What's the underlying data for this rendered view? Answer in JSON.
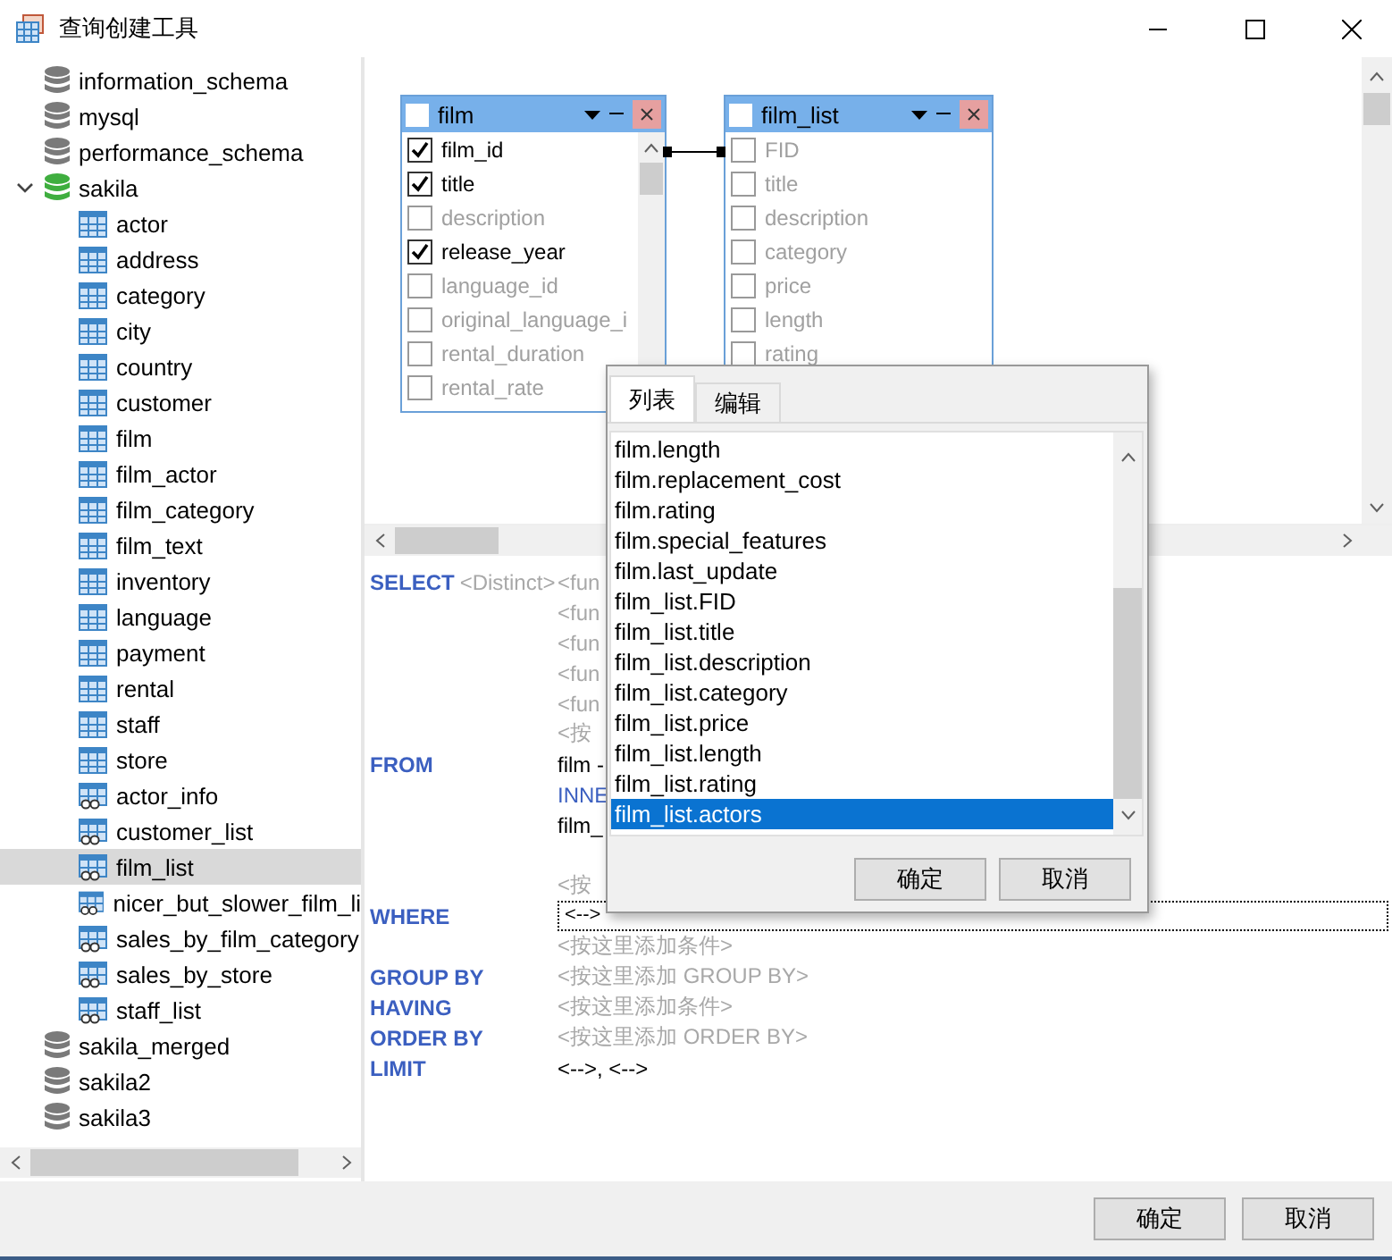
{
  "window": {
    "title": "查询创建工具"
  },
  "tree": [
    {
      "label": "information_schema",
      "kind": "database",
      "active": false,
      "selected": false
    },
    {
      "label": "mysql",
      "kind": "database",
      "active": false,
      "selected": false
    },
    {
      "label": "performance_schema",
      "kind": "database",
      "active": false,
      "selected": false
    },
    {
      "label": "sakila",
      "kind": "database",
      "active": true,
      "expanded": true,
      "selected": false,
      "children": [
        {
          "label": "actor",
          "kind": "table",
          "selected": false
        },
        {
          "label": "address",
          "kind": "table",
          "selected": false
        },
        {
          "label": "category",
          "kind": "table",
          "selected": false
        },
        {
          "label": "city",
          "kind": "table",
          "selected": false
        },
        {
          "label": "country",
          "kind": "table",
          "selected": false
        },
        {
          "label": "customer",
          "kind": "table",
          "selected": false
        },
        {
          "label": "film",
          "kind": "table",
          "selected": false
        },
        {
          "label": "film_actor",
          "kind": "table",
          "selected": false
        },
        {
          "label": "film_category",
          "kind": "table",
          "selected": false
        },
        {
          "label": "film_text",
          "kind": "table",
          "selected": false
        },
        {
          "label": "inventory",
          "kind": "table",
          "selected": false
        },
        {
          "label": "language",
          "kind": "table",
          "selected": false
        },
        {
          "label": "payment",
          "kind": "table",
          "selected": false
        },
        {
          "label": "rental",
          "kind": "table",
          "selected": false
        },
        {
          "label": "staff",
          "kind": "table",
          "selected": false
        },
        {
          "label": "store",
          "kind": "table",
          "selected": false
        },
        {
          "label": "actor_info",
          "kind": "view",
          "selected": false
        },
        {
          "label": "customer_list",
          "kind": "view",
          "selected": false
        },
        {
          "label": "film_list",
          "kind": "view",
          "selected": true
        },
        {
          "label": "nicer_but_slower_film_li",
          "kind": "view",
          "selected": false
        },
        {
          "label": "sales_by_film_category",
          "kind": "view",
          "selected": false
        },
        {
          "label": "sales_by_store",
          "kind": "view",
          "selected": false
        },
        {
          "label": "staff_list",
          "kind": "view",
          "selected": false
        }
      ]
    },
    {
      "label": "sakila_merged",
      "kind": "database",
      "active": false,
      "selected": false
    },
    {
      "label": "sakila2",
      "kind": "database",
      "active": false,
      "selected": false
    },
    {
      "label": "sakila3",
      "kind": "database",
      "active": false,
      "selected": false
    }
  ],
  "diagram": {
    "tables": [
      {
        "name": "film",
        "checked": false,
        "scrollable": true,
        "fields": [
          {
            "name": "film_id",
            "checked": true
          },
          {
            "name": "title",
            "checked": true
          },
          {
            "name": "description",
            "checked": false
          },
          {
            "name": "release_year",
            "checked": true
          },
          {
            "name": "language_id",
            "checked": false
          },
          {
            "name": "original_language_i",
            "checked": false
          },
          {
            "name": "rental_duration",
            "checked": false
          },
          {
            "name": "rental_rate",
            "checked": false
          }
        ]
      },
      {
        "name": "film_list",
        "checked": false,
        "scrollable": false,
        "fields": [
          {
            "name": "FID",
            "checked": false
          },
          {
            "name": "title",
            "checked": false
          },
          {
            "name": "description",
            "checked": false
          },
          {
            "name": "category",
            "checked": false
          },
          {
            "name": "price",
            "checked": false
          },
          {
            "name": "length",
            "checked": false
          },
          {
            "name": "rating",
            "checked": false
          }
        ]
      }
    ]
  },
  "sql": {
    "rows": [
      {
        "keyword": "SELECT",
        "modifier": "<Distinct>",
        "text": "<fun",
        "kind": "placeholder"
      },
      {
        "text": "<fun",
        "kind": "placeholder"
      },
      {
        "text": "<fun",
        "kind": "placeholder"
      },
      {
        "text": "<fun",
        "kind": "placeholder"
      },
      {
        "text": "<fun",
        "kind": "placeholder"
      },
      {
        "text": "<按",
        "kind": "placeholder"
      },
      {
        "keyword": "FROM",
        "text": "film -",
        "kind": "value"
      },
      {
        "text": "INNE",
        "kind": "join"
      },
      {
        "text": "film_",
        "kind": "value"
      },
      {
        "kind": "blank"
      },
      {
        "text": "<按",
        "kind": "placeholder"
      },
      {
        "keyword": "WHERE",
        "text": "<-->",
        "kind": "field"
      },
      {
        "text": "<按这里添加条件>",
        "kind": "placeholder"
      },
      {
        "keyword": "GROUP BY",
        "text": "<按这里添加 GROUP BY>",
        "kind": "placeholder"
      },
      {
        "keyword": "HAVING",
        "text": "<按这里添加条件>",
        "kind": "placeholder"
      },
      {
        "keyword": "ORDER BY",
        "text": "<按这里添加 ORDER BY>",
        "kind": "placeholder"
      },
      {
        "keyword": "LIMIT",
        "text": "<-->, <-->",
        "kind": "value"
      }
    ]
  },
  "popup": {
    "tabs": [
      {
        "label": "列表",
        "selected": true
      },
      {
        "label": "编辑",
        "selected": false
      }
    ],
    "items": [
      {
        "label": "film.length",
        "selected": false
      },
      {
        "label": "film.replacement_cost",
        "selected": false
      },
      {
        "label": "film.rating",
        "selected": false
      },
      {
        "label": "film.special_features",
        "selected": false
      },
      {
        "label": "film.last_update",
        "selected": false
      },
      {
        "label": "film_list.FID",
        "selected": false
      },
      {
        "label": "film_list.title",
        "selected": false
      },
      {
        "label": "film_list.description",
        "selected": false
      },
      {
        "label": "film_list.category",
        "selected": false
      },
      {
        "label": "film_list.price",
        "selected": false
      },
      {
        "label": "film_list.length",
        "selected": false
      },
      {
        "label": "film_list.rating",
        "selected": false
      },
      {
        "label": "film_list.actors",
        "selected": true
      }
    ],
    "buttons": [
      "确定",
      "取消"
    ]
  },
  "buttons": [
    "确定",
    "取消"
  ]
}
